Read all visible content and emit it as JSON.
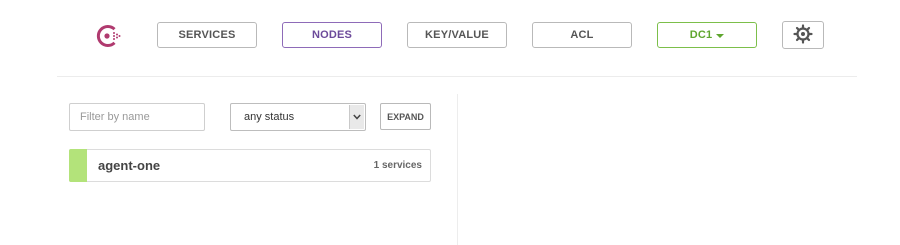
{
  "nav": {
    "logo_icon": "consul-logo-icon",
    "services_label": "SERVICES",
    "nodes_label": "NODES",
    "kv_label": "KEY/VALUE",
    "acl_label": "ACL",
    "dc_label": "DC1",
    "settings_icon": "gear-icon",
    "active_tab": "NODES"
  },
  "filters": {
    "name_placeholder": "Filter by name",
    "name_value": "",
    "status_value": "any status",
    "expand_label": "EXPAND"
  },
  "nodes": [
    {
      "name": "agent-one",
      "services": "1 services",
      "status_color": "#b3e37a"
    }
  ],
  "colors": {
    "active_nav": "#8e6bb8",
    "dc_green": "#7cbf4a",
    "passing": "#b3e37a"
  }
}
